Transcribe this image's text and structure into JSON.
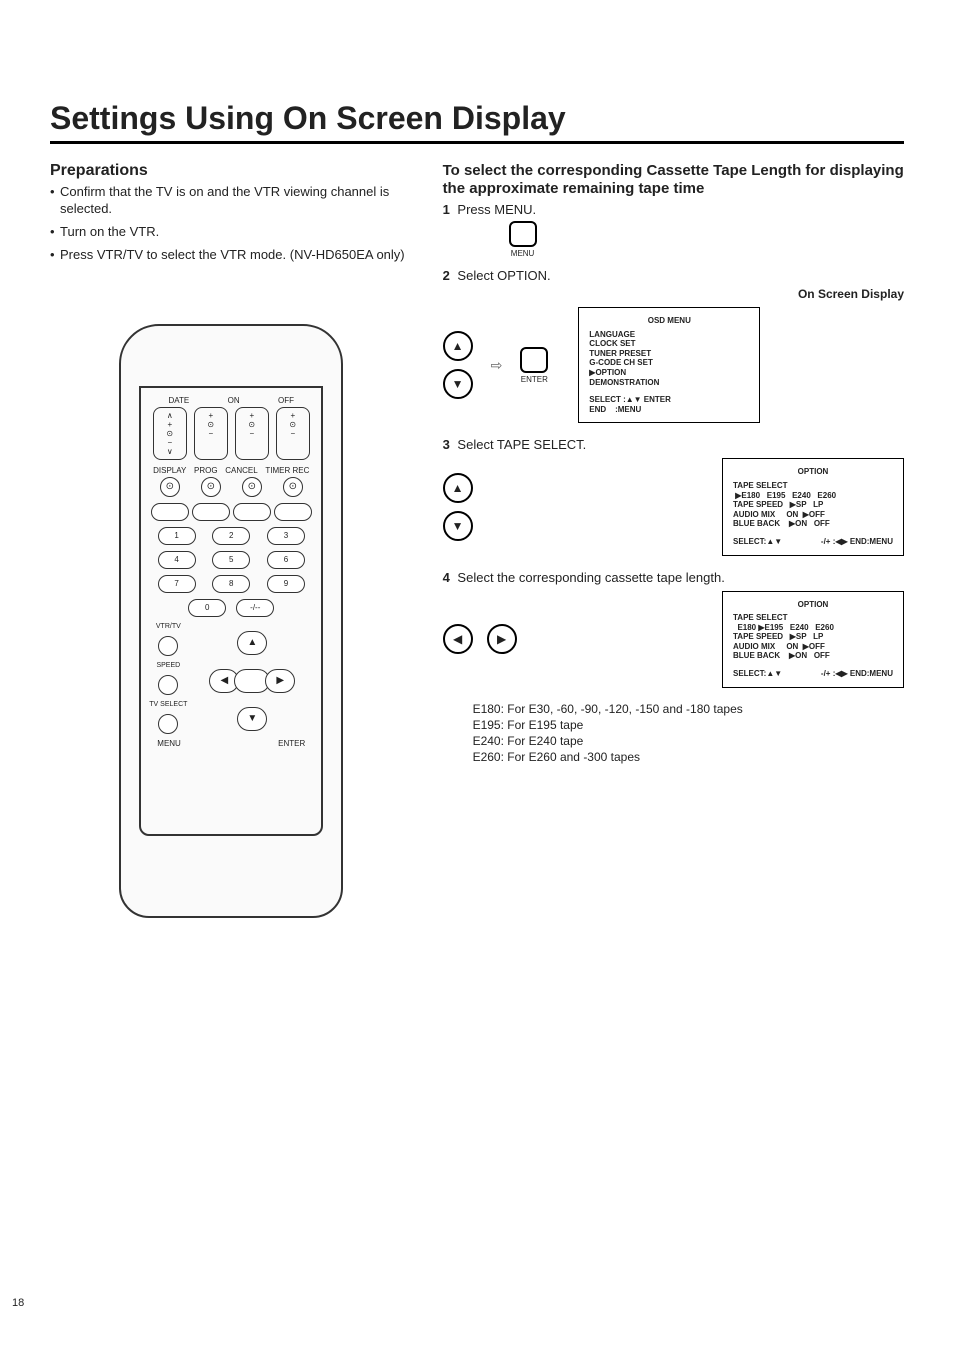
{
  "page_number": "18",
  "title": "Settings Using On Screen Display",
  "preparations": {
    "heading": "Preparations",
    "bullets": [
      "Confirm that the TV is on and the VTR viewing channel is selected.",
      "Turn on the VTR.",
      "Press VTR/TV to select the VTR mode. (NV-HD650EA only)"
    ]
  },
  "remote": {
    "labels": {
      "date": "DATE",
      "on": "ON",
      "off": "OFF"
    },
    "row2": [
      "DISPLAY",
      "PROG",
      "CANCEL",
      "TIMER REC"
    ],
    "numpad": [
      [
        "1",
        "2",
        "3"
      ],
      [
        "4",
        "5",
        "6"
      ],
      [
        "7",
        "8",
        "9"
      ],
      [
        "0"
      ]
    ],
    "zero_right": "-/--",
    "bottom": {
      "menu": "MENU",
      "enter": "ENTER"
    },
    "side": {
      "vtrtv": "VTR/TV",
      "speed": "SPEED",
      "tvselect": "TV SELECT"
    }
  },
  "cassette_heading": "To select the corresponding Cassette Tape Length for displaying the approximate remaining tape time",
  "step1": {
    "num": "1",
    "text": "Press MENU.",
    "btn_caption": "MENU"
  },
  "step2": {
    "num": "2",
    "text": "Select OPTION.",
    "osd_label": "On Screen Display",
    "enter_caption": "ENTER",
    "osd": {
      "title": "OSD MENU",
      "items": [
        "LANGUAGE",
        "CLOCK SET",
        "TUNER PRESET",
        "G-CODE CH SET",
        "▶OPTION",
        "DEMONSTRATION"
      ],
      "footer_left": "SELECT :▲▼ ENTER",
      "footer_right": "END    :MENU"
    }
  },
  "step3": {
    "num": "3",
    "text": "Select TAPE SELECT.",
    "osd": {
      "title": "OPTION",
      "lines": [
        "TAPE SELECT",
        " ▶E180   E195   E240   E260",
        "TAPE SPEED   ▶SP   LP",
        "AUDIO MIX     ON  ▶OFF",
        "BLUE BACK    ▶ON   OFF"
      ],
      "footer_left": "SELECT:▲▼",
      "footer_right": "-/+ :◀▶  END:MENU"
    }
  },
  "step4": {
    "num": "4",
    "text": "Select the corresponding cassette tape length.",
    "osd": {
      "title": "OPTION",
      "lines": [
        "TAPE SELECT",
        "  E180 ▶E195   E240   E260",
        "TAPE SPEED   ▶SP   LP",
        "AUDIO MIX     ON  ▶OFF",
        "BLUE BACK    ▶ON   OFF"
      ],
      "footer_left": "SELECT:▲▼",
      "footer_right": "-/+ :◀▶  END:MENU"
    }
  },
  "tape_lengths": [
    {
      "code": "E180:",
      "desc": "For E30, -60, -90, -120, -150 and -180 tapes"
    },
    {
      "code": "E195:",
      "desc": "For E195 tape"
    },
    {
      "code": "E240:",
      "desc": "For E240 tape"
    },
    {
      "code": "E260:",
      "desc": "For E260 and -300 tapes"
    }
  ]
}
